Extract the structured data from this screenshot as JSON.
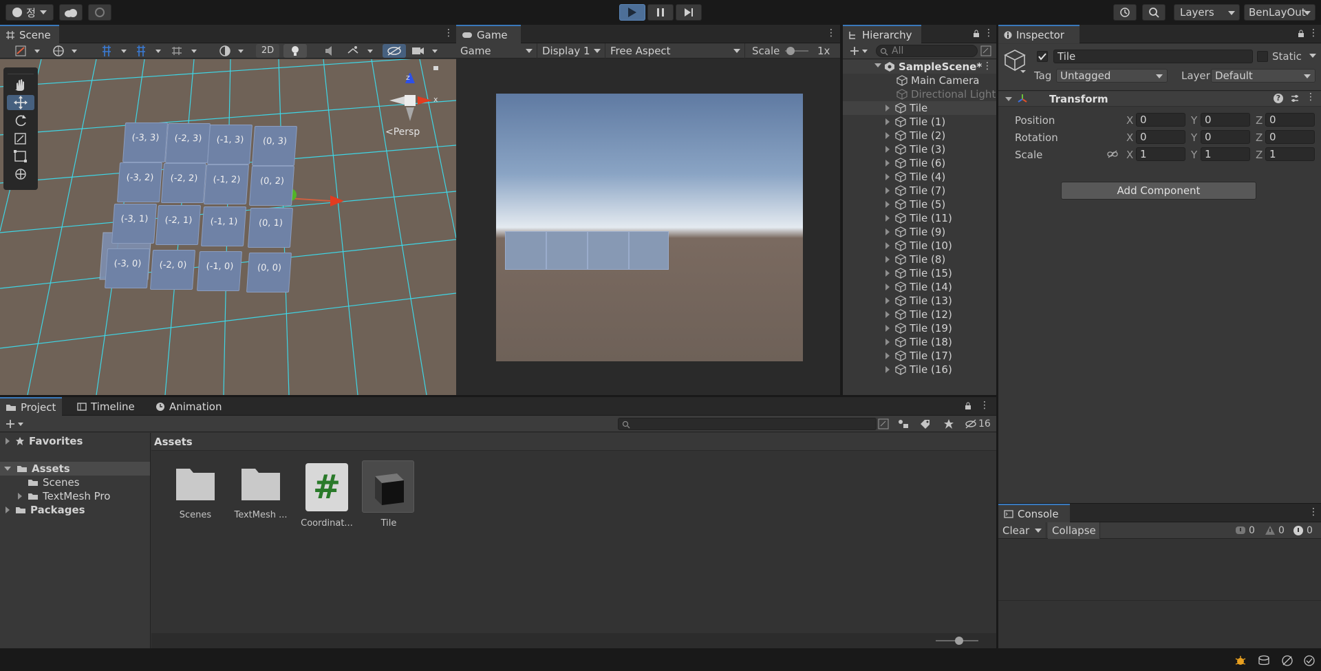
{
  "toolbar": {
    "account_initial": "정",
    "layers_label": "Layers",
    "layout_label": "BenLayOut"
  },
  "scene": {
    "tab": "Scene",
    "btn_2d": "2D",
    "persp": "<Persp",
    "axis_x": "x",
    "axis_z": "z",
    "tiles": [
      "(-3, 3)",
      "(-2, 3)",
      "(-1, 3)",
      "(0, 3)",
      "(-3, 2)",
      "(-2, 2)",
      "(-1, 2)",
      "(0, 2)",
      "(-3, 1)",
      "(-2, 1)",
      "(-1, 1)",
      "(0, 1)",
      "(-3, 0)",
      "(-2, 0)",
      "(-1, 0)",
      "(0, 0)"
    ]
  },
  "game": {
    "tab": "Game",
    "mode": "Game",
    "display": "Display 1",
    "aspect": "Free Aspect",
    "scale_label": "Scale",
    "scale_value": "1x"
  },
  "hierarchy": {
    "tab": "Hierarchy",
    "search_placeholder": "All",
    "scene_name": "SampleScene*",
    "items": [
      "Main Camera",
      "Directional Light",
      "Tile",
      "Tile (1)",
      "Tile (2)",
      "Tile (3)",
      "Tile (6)",
      "Tile (4)",
      "Tile (7)",
      "Tile (5)",
      "Tile (11)",
      "Tile (9)",
      "Tile (10)",
      "Tile (8)",
      "Tile (15)",
      "Tile (14)",
      "Tile (13)",
      "Tile (12)",
      "Tile (19)",
      "Tile (18)",
      "Tile (17)",
      "Tile (16)"
    ]
  },
  "inspector": {
    "tab": "Inspector",
    "object_name": "Tile",
    "static_label": "Static",
    "tag_label": "Tag",
    "tag_value": "Untagged",
    "layer_label": "Layer",
    "layer_value": "Default",
    "component": "Transform",
    "position_label": "Position",
    "rotation_label": "Rotation",
    "scale_label": "Scale",
    "position": [
      "0",
      "0",
      "0"
    ],
    "rotation": [
      "0",
      "0",
      "0"
    ],
    "scale": [
      "1",
      "1",
      "1"
    ],
    "axis_x": "X",
    "axis_y": "Y",
    "axis_z": "Z",
    "add_component": "Add Component"
  },
  "project": {
    "tabs": [
      "Project",
      "Timeline",
      "Animation"
    ],
    "favorites": "Favorites",
    "assets": "Assets",
    "scenes": "Scenes",
    "textmesh": "TextMesh Pro",
    "packages": "Packages",
    "breadcrumb": "Assets",
    "hidden_count": "16",
    "grid": [
      "Scenes",
      "TextMesh ...",
      "Coordinat...",
      "Tile"
    ],
    "script_glyph": "#"
  },
  "console": {
    "tab": "Console",
    "clear": "Clear",
    "collapse": "Collapse",
    "info_count": "0",
    "warn_count": "0",
    "error_count": "0"
  }
}
